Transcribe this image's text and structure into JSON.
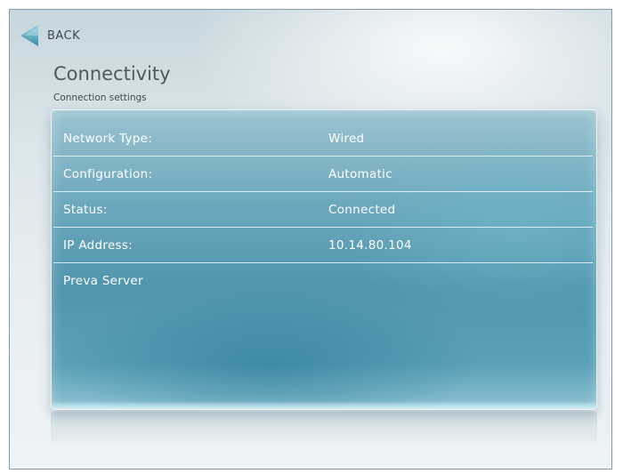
{
  "nav": {
    "back_label": "BACK"
  },
  "header": {
    "title": "Connectivity",
    "subtitle": "Connection settings"
  },
  "settings": [
    {
      "label": "Network Type:",
      "value": "Wired"
    },
    {
      "label": "Configuration:",
      "value": "Automatic"
    },
    {
      "label": "Status:",
      "value": "Connected"
    },
    {
      "label": "IP Address:",
      "value": "10.14.80.104"
    },
    {
      "label": "Preva Server",
      "value": ""
    }
  ],
  "icons": {
    "back": "back-arrow-icon"
  },
  "colors": {
    "panel": "#4f95ad",
    "panel_light": "#9cc4d2",
    "text_on_panel": "#ffffff",
    "back_arrow": "#5aa6bf",
    "background": "#dbe6ea"
  }
}
